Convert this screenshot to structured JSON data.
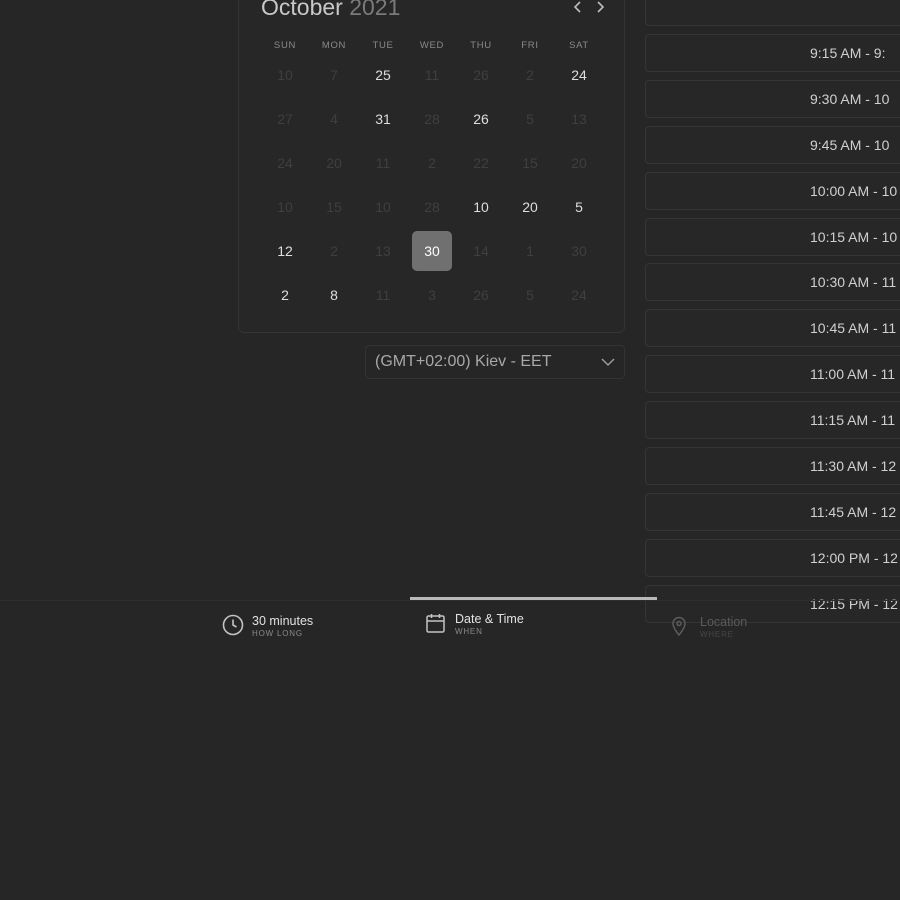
{
  "calendar": {
    "month": "October",
    "year": "2021",
    "weekdays": [
      "SUN",
      "MON",
      "TUE",
      "WED",
      "THU",
      "FRI",
      "SAT"
    ],
    "weeks": [
      [
        {
          "label": "10",
          "active": false
        },
        {
          "label": "7",
          "active": false
        },
        {
          "label": "25",
          "active": true
        },
        {
          "label": "11",
          "active": false
        },
        {
          "label": "26",
          "active": false
        },
        {
          "label": "2",
          "active": false
        },
        {
          "label": "24",
          "active": true
        }
      ],
      [
        {
          "label": "27",
          "active": false
        },
        {
          "label": "4",
          "active": false
        },
        {
          "label": "31",
          "active": true
        },
        {
          "label": "28",
          "active": false
        },
        {
          "label": "26",
          "active": true
        },
        {
          "label": "5",
          "active": false
        },
        {
          "label": "13",
          "active": false
        }
      ],
      [
        {
          "label": "24",
          "active": false
        },
        {
          "label": "20",
          "active": false
        },
        {
          "label": "11",
          "active": false
        },
        {
          "label": "2",
          "active": false
        },
        {
          "label": "22",
          "active": false
        },
        {
          "label": "15",
          "active": false
        },
        {
          "label": "20",
          "active": false
        }
      ],
      [
        {
          "label": "10",
          "active": false
        },
        {
          "label": "15",
          "active": false
        },
        {
          "label": "10",
          "active": false
        },
        {
          "label": "28",
          "active": false
        },
        {
          "label": "10",
          "active": true
        },
        {
          "label": "20",
          "active": true
        },
        {
          "label": "5",
          "active": true
        }
      ],
      [
        {
          "label": "12",
          "active": true
        },
        {
          "label": "2",
          "active": false
        },
        {
          "label": "13",
          "active": false
        },
        {
          "label": "30",
          "active": true,
          "selected": true
        },
        {
          "label": "14",
          "active": false
        },
        {
          "label": "1",
          "active": false
        },
        {
          "label": "30",
          "active": false
        }
      ],
      [
        {
          "label": "2",
          "active": true
        },
        {
          "label": "8",
          "active": true
        },
        {
          "label": "11",
          "active": false
        },
        {
          "label": "3",
          "active": false
        },
        {
          "label": "26",
          "active": false
        },
        {
          "label": "5",
          "active": false
        },
        {
          "label": "24",
          "active": false
        }
      ]
    ]
  },
  "timezone": {
    "label": "(GMT+02:00) Kiev - EET"
  },
  "time_slots": [
    "",
    "9:15 AM - 9:",
    "9:30 AM - 10",
    "9:45 AM - 10",
    "10:00 AM - 10",
    "10:15 AM - 10",
    "10:30 AM - 11",
    "10:45 AM - 11",
    "11:00 AM - 11",
    "11:15 AM - 11",
    "11:30 AM - 12",
    "11:45 AM - 12",
    "12:00 PM - 12",
    "12:15 PM - 12"
  ],
  "steps": {
    "duration": {
      "title": "30 minutes",
      "subtitle": "HOW LONG",
      "icon": "clock-icon"
    },
    "datetime": {
      "title": "Date & Time",
      "subtitle": "WHEN",
      "icon": "calendar-icon"
    },
    "location": {
      "title": "Location",
      "subtitle": "WHERE",
      "icon": "map-pin-icon"
    }
  },
  "colors": {
    "background": "#262626",
    "selected_day": "#707070",
    "active_text": "#dedede",
    "inactive_text": "#3f3f3f",
    "active_step_indicator": "#b9b9b9"
  }
}
